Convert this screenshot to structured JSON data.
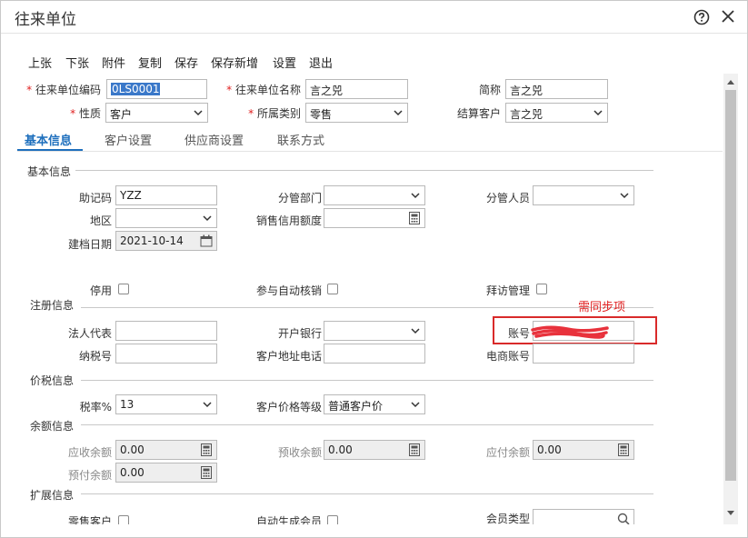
{
  "window": {
    "title": "往来单位"
  },
  "toolbar": {
    "prev": "上张",
    "next": "下张",
    "attach": "附件",
    "copy": "复制",
    "save": "保存",
    "save_new": "保存新增",
    "settings": "设置",
    "exit": "退出"
  },
  "header": {
    "code_label": "往来单位编码",
    "code_value": "0LS0001",
    "name_label": "往来单位名称",
    "name_value": "言之兕",
    "short_label": "简称",
    "short_value": "言之兕",
    "nature_label": "性质",
    "nature_value": "客户",
    "category_label": "所属类别",
    "category_value": "零售",
    "settle_label": "结算客户",
    "settle_value": "言之兕"
  },
  "tabs": [
    "基本信息",
    "客户设置",
    "供应商设置",
    "联系方式"
  ],
  "basic": {
    "section": "基本信息",
    "mnemonic_label": "助记码",
    "mnemonic_value": "YZZ",
    "dept_label": "分管部门",
    "dept_value": "",
    "staff_label": "分管人员",
    "staff_value": "",
    "region_label": "地区",
    "region_value": "",
    "credit_label": "销售信用额度",
    "credit_value": "",
    "date_label": "建档日期",
    "date_value": "2021-10-14",
    "disable_label": "停用",
    "autoverify_label": "参与自动核销",
    "visit_label": "拜访管理"
  },
  "registration": {
    "section": "注册信息",
    "legal_label": "法人代表",
    "legal_value": "",
    "bank_label": "开户银行",
    "bank_value": "",
    "account_label": "账号",
    "tax_label": "纳税号",
    "tax_value": "",
    "addr_label": "客户地址电话",
    "addr_value": "",
    "ecom_label": "电商账号",
    "ecom_value": ""
  },
  "annotation": {
    "text": "需同步项",
    "color": "#e02020"
  },
  "tax": {
    "section": "价税信息",
    "rate_label": "税率%",
    "rate_value": "13",
    "price_label": "客户价格等级",
    "price_value": "普通客户价"
  },
  "balance": {
    "section": "余额信息",
    "receivable_label": "应收余额",
    "receivable_value": "0.00",
    "prereceive_label": "预收余额",
    "prereceive_value": "0.00",
    "payable_label": "应付余额",
    "payable_value": "0.00",
    "prepay_label": "预付余额",
    "prepay_value": "0.00"
  },
  "ext": {
    "section": "扩展信息",
    "retail_label": "零售客户",
    "member_auto_label": "自动生成会员",
    "member_type_label": "会员类型"
  },
  "colors": {
    "accent": "#1e6fbd",
    "required": "#e02020"
  }
}
